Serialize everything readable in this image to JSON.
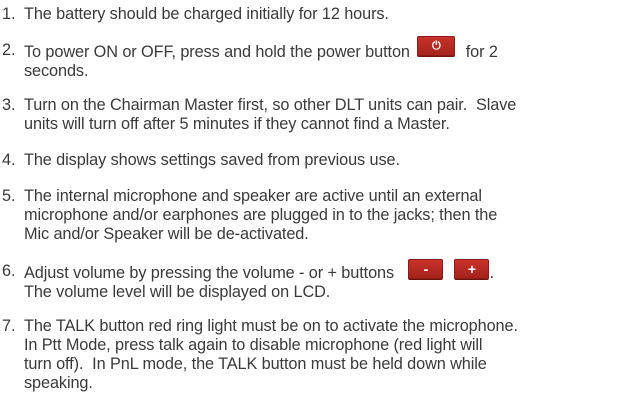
{
  "items": [
    {
      "num": "1.",
      "text": "The battery should be charged initially for 12 hours."
    },
    {
      "num": "2.",
      "text_before": "To power ON or OFF, press and hold the power button",
      "power_glyph": "⏻",
      "text_after_line1": "for 2",
      "text_line2": "seconds."
    },
    {
      "num": "3.",
      "line1": "Turn on the Chairman Master first, so other DLT units can pair.  Slave",
      "line2": "units will turn off after 5 minutes if they cannot find a Master."
    },
    {
      "num": "4.",
      "text": "The display shows settings saved from previous use."
    },
    {
      "num": "5.",
      "line1": "The internal microphone and speaker are active until an external",
      "line2": "microphone and/or earphones are plugged in to the jacks; then the",
      "line3": "Mic and/or Speaker will be de-activated."
    },
    {
      "num": "6.",
      "text_before": "Adjust volume by pressing the volume - or + buttons",
      "minus_glyph": "-",
      "plus_glyph": "+",
      "text_after": ".",
      "line2": "The volume level will be displayed on LCD."
    },
    {
      "num": "7.",
      "line1": "The TALK button red ring light must be on to activate the microphone.",
      "line2": "In Ptt Mode, press talk again to disable microphone (red light will",
      "line3": "turn off).  In PnL mode, the TALK button must be held down while",
      "line4": "speaking."
    }
  ],
  "colors": {
    "text": "#3a3a3a",
    "button_red": "#b8291f",
    "button_text": "#ffffff"
  }
}
